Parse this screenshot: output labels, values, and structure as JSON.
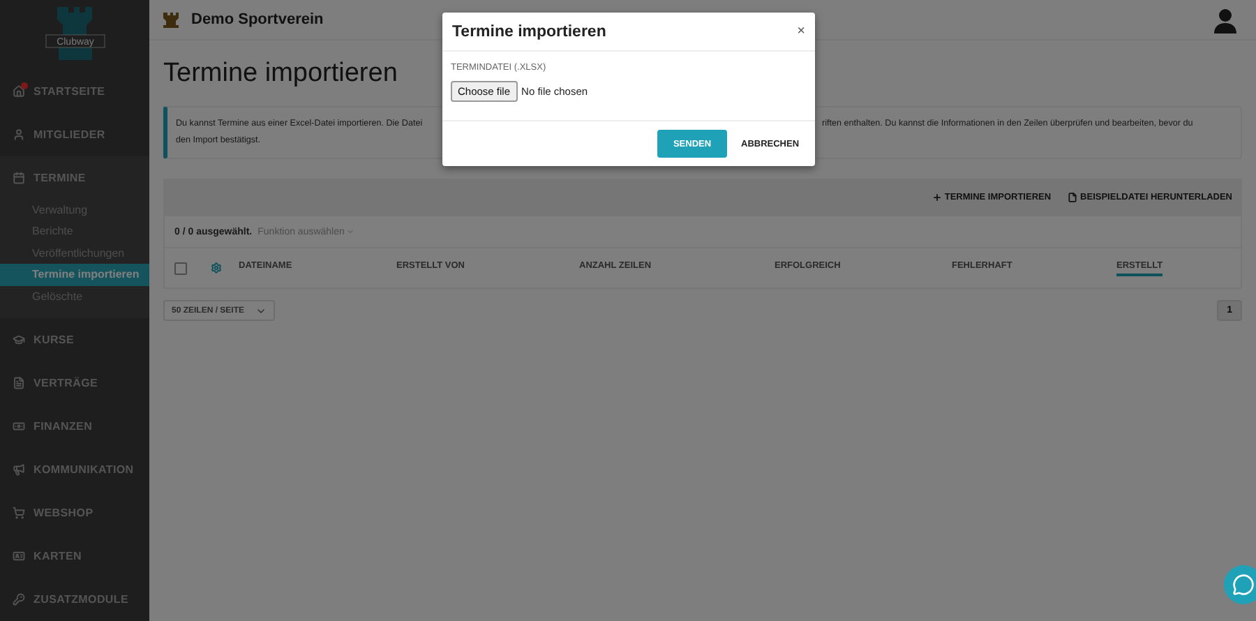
{
  "sidebar": {
    "logo_text": "Clubway",
    "items": [
      {
        "label": "STARTSEITE",
        "notification": true,
        "expanded": false
      },
      {
        "label": "MITGLIEDER",
        "notification": false,
        "expanded": false
      },
      {
        "label": "TERMINE",
        "notification": false,
        "expanded": true,
        "children": [
          {
            "label": "Verwaltung",
            "selected": false
          },
          {
            "label": "Berichte",
            "selected": false
          },
          {
            "label": "Veröffentlichungen",
            "selected": false
          },
          {
            "label": "Termine importieren",
            "selected": true
          },
          {
            "label": "Gelöschte",
            "selected": false
          }
        ]
      },
      {
        "label": "KURSE",
        "notification": false,
        "expanded": false
      },
      {
        "label": "VERTRÄGE",
        "notification": false,
        "expanded": false
      },
      {
        "label": "FINANZEN",
        "notification": false,
        "expanded": false
      },
      {
        "label": "KOMMUNIKATION",
        "notification": false,
        "expanded": false
      },
      {
        "label": "WEBSHOP",
        "notification": false,
        "expanded": false
      },
      {
        "label": "KARTEN",
        "notification": false,
        "expanded": false
      },
      {
        "label": "ZUSATZMODULE",
        "notification": false,
        "expanded": false
      }
    ]
  },
  "topbar": {
    "club_name": "Demo Sportverein"
  },
  "page": {
    "title": "Termine importieren"
  },
  "info": {
    "line_1_start": "Du kannst Termine aus einer Excel-Datei importieren. Die Datei",
    "line_1_end": "riften enthalten. Du kannst die Informationen in den Zeilen überprüfen und bearbeiten, bevor du",
    "line_2": "den Import bestätigst."
  },
  "toolbar": {
    "actions": [
      {
        "label": "TERMINE IMPORTIEREN"
      },
      {
        "label": "BEISPIELDATEI HERUNTERLADEN"
      }
    ]
  },
  "selection": {
    "count": "0 / 0 ausgewählt.",
    "function": "Funktion auswählen"
  },
  "table": {
    "columns": [
      {
        "label": "DATEINAME",
        "sorted": false
      },
      {
        "label": "ERSTELLT VON",
        "sorted": false
      },
      {
        "label": "ANZAHL ZEILEN",
        "sorted": false
      },
      {
        "label": "ERFOLGREICH",
        "sorted": false
      },
      {
        "label": "FEHLERHAFT",
        "sorted": false
      },
      {
        "label": "ERSTELLT",
        "sorted": true
      }
    ],
    "all_checked": false
  },
  "footer": {
    "page_size": "50 ZEILEN / SEITE",
    "pages": [
      {
        "label": "1",
        "selected": true
      }
    ]
  },
  "modal": {
    "title": "Termine importieren",
    "close": "×",
    "field_label": "TERMINDATEI (.XLSX)",
    "file_button": "Choose file",
    "file_status": "No file chosen",
    "buttons": [
      {
        "label": "SENDEN",
        "kind": "primary"
      },
      {
        "label": "ABBRECHEN",
        "kind": "secondary"
      }
    ]
  }
}
